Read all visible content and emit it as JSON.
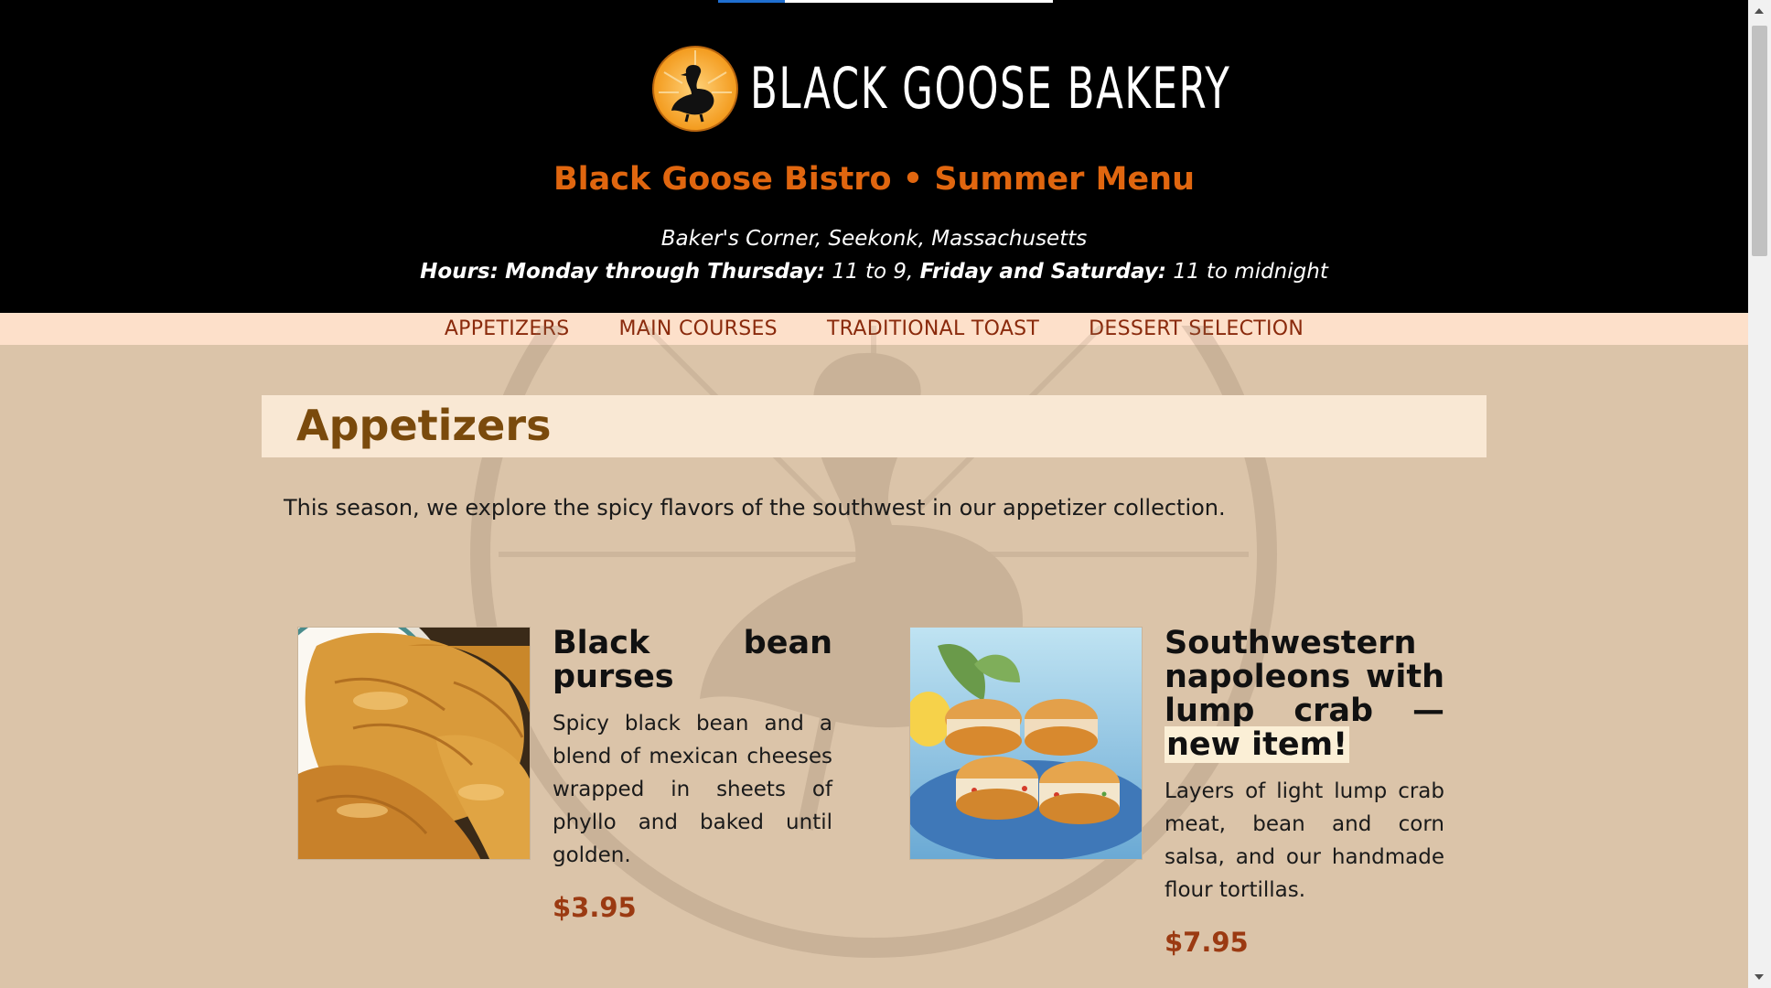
{
  "header": {
    "logo_text": "BLACK GOOSE BAKERY",
    "title": "Black Goose Bistro • Summer Menu",
    "address": "Baker's Corner, Seekonk, Massachusetts",
    "hours": {
      "label": "Hours:",
      "weekday_label": "Monday through Thursday:",
      "weekday_value": "11 to 9,",
      "weekend_label": "Friday and Saturday:",
      "weekend_value": "11 to midnight"
    }
  },
  "nav": {
    "items": [
      "APPETIZERS",
      "MAIN COURSES",
      "TRADITIONAL TOAST",
      "DESSERT SELECTION"
    ]
  },
  "section": {
    "title": "Appetizers",
    "intro": "This season, we explore the spicy flavors of the southwest in our appetizer collection."
  },
  "items": [
    {
      "name": "Black bean purses",
      "badge": "",
      "description": "Spicy black bean and a blend of mexican cheeses wrapped in sheets of phyllo and baked until golden.",
      "price": "$3.95",
      "photo_icon": "pastry-photo"
    },
    {
      "name": "Southwestern napoleons with lump crab —",
      "badge": "new item!",
      "description": "Layers of light lump crab meat, bean and corn salsa, and our handmade flour tortillas.",
      "price": "$7.95",
      "photo_icon": "napoleon-photo"
    }
  ],
  "colors": {
    "header_bg": "#000000",
    "accent_orange": "#e0660f",
    "nav_bg": "#fde0ca",
    "nav_text": "#8a2a0c",
    "page_bg": "#dbc4a9",
    "price": "#9b3a12",
    "section_title": "#7a4a0c"
  }
}
